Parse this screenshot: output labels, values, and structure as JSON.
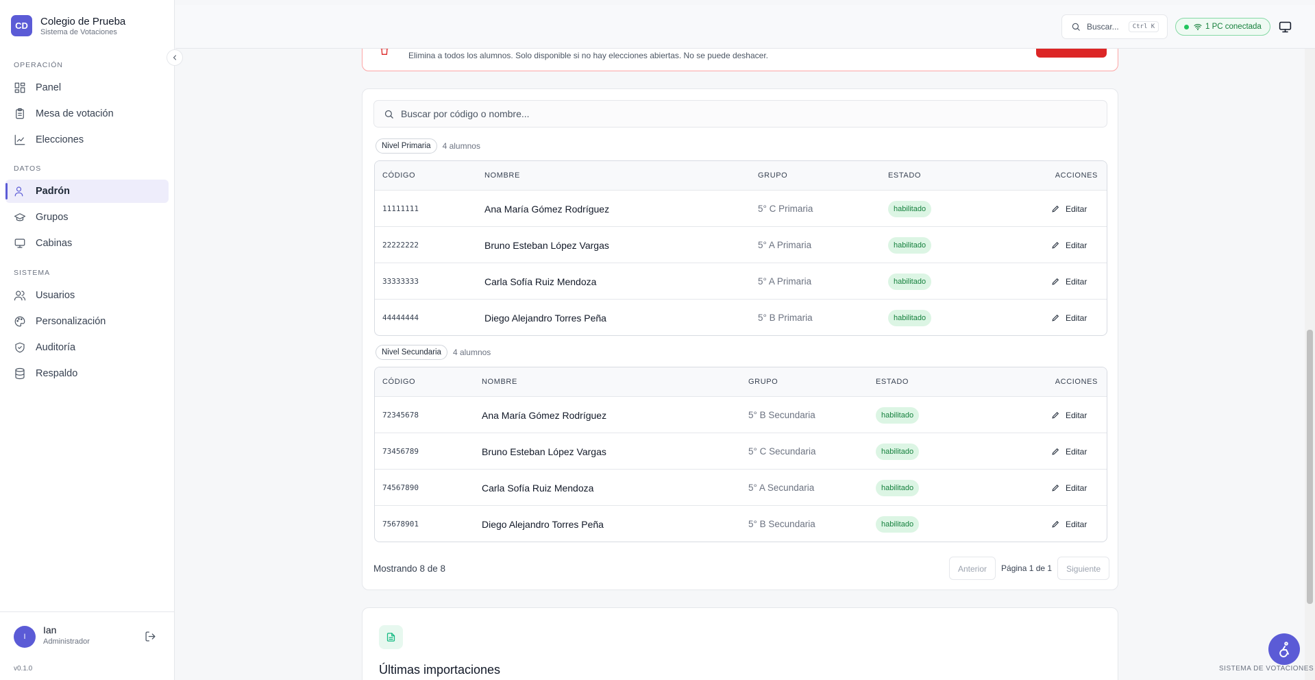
{
  "brand": {
    "initials": "CD",
    "name": "Colegio de Prueba",
    "subtitle": "Sistema de Votaciones"
  },
  "sidebar": {
    "sections": [
      {
        "label": "OPERACIÓN",
        "items": [
          {
            "label": "Panel",
            "icon": "layout-dashboard-icon"
          },
          {
            "label": "Mesa de votación",
            "icon": "clipboard-list-icon"
          },
          {
            "label": "Elecciones",
            "icon": "chart-icon"
          }
        ]
      },
      {
        "label": "DATOS",
        "items": [
          {
            "label": "Padrón",
            "icon": "user-icon",
            "active": true
          },
          {
            "label": "Grupos",
            "icon": "graduation-cap-icon"
          },
          {
            "label": "Cabinas",
            "icon": "monitor-icon"
          }
        ]
      },
      {
        "label": "SISTEMA",
        "items": [
          {
            "label": "Usuarios",
            "icon": "users-icon"
          },
          {
            "label": "Personalización",
            "icon": "palette-icon"
          },
          {
            "label": "Auditoría",
            "icon": "shield-check-icon"
          },
          {
            "label": "Respaldo",
            "icon": "database-icon"
          }
        ]
      }
    ],
    "user": {
      "initial": "I",
      "name": "Ian",
      "role": "Administrador"
    },
    "version": "v0.1.0"
  },
  "topbar": {
    "search_placeholder": "Buscar...",
    "shortcut": "Ctrl K",
    "connection_status": "1 PC conectada",
    "status_color": "#22c55e"
  },
  "danger": {
    "description": "Elimina a todos los alumnos. Solo disponible si no hay elecciones abiertas. No se puede deshacer."
  },
  "search": {
    "placeholder": "Buscar por código o nombre..."
  },
  "table_headers": {
    "code": "CÓDIGO",
    "name": "NOMBRE",
    "group": "GRUPO",
    "status": "ESTADO",
    "actions": "ACCIONES"
  },
  "levels": [
    {
      "badge": "Nivel Primaria",
      "count": "4 alumnos",
      "rows": [
        {
          "code": "11111111",
          "name": "Ana María Gómez Rodríguez",
          "group": "5° C Primaria",
          "status": "habilitado",
          "action": "Editar"
        },
        {
          "code": "22222222",
          "name": "Bruno Esteban López Vargas",
          "group": "5° A Primaria",
          "status": "habilitado",
          "action": "Editar"
        },
        {
          "code": "33333333",
          "name": "Carla Sofía Ruiz Mendoza",
          "group": "5° A Primaria",
          "status": "habilitado",
          "action": "Editar"
        },
        {
          "code": "44444444",
          "name": "Diego Alejandro Torres Peña",
          "group": "5° B Primaria",
          "status": "habilitado",
          "action": "Editar"
        }
      ]
    },
    {
      "badge": "Nivel Secundaria",
      "count": "4 alumnos",
      "rows": [
        {
          "code": "72345678",
          "name": "Ana María Gómez Rodríguez",
          "group": "5° B Secundaria",
          "status": "habilitado",
          "action": "Editar"
        },
        {
          "code": "73456789",
          "name": "Bruno Esteban López Vargas",
          "group": "5° C Secundaria",
          "status": "habilitado",
          "action": "Editar"
        },
        {
          "code": "74567890",
          "name": "Carla Sofía Ruiz Mendoza",
          "group": "5° A Secundaria",
          "status": "habilitado",
          "action": "Editar"
        },
        {
          "code": "75678901",
          "name": "Diego Alejandro Torres Peña",
          "group": "5° B Secundaria",
          "status": "habilitado",
          "action": "Editar"
        }
      ]
    }
  ],
  "pagination": {
    "showing": "Mostrando 8 de 8",
    "prev": "Anterior",
    "page": "Página 1 de 1",
    "next": "Siguiente"
  },
  "imports": {
    "title": "Últimas importaciones"
  },
  "footer_label": "SISTEMA DE VOTACIONES"
}
